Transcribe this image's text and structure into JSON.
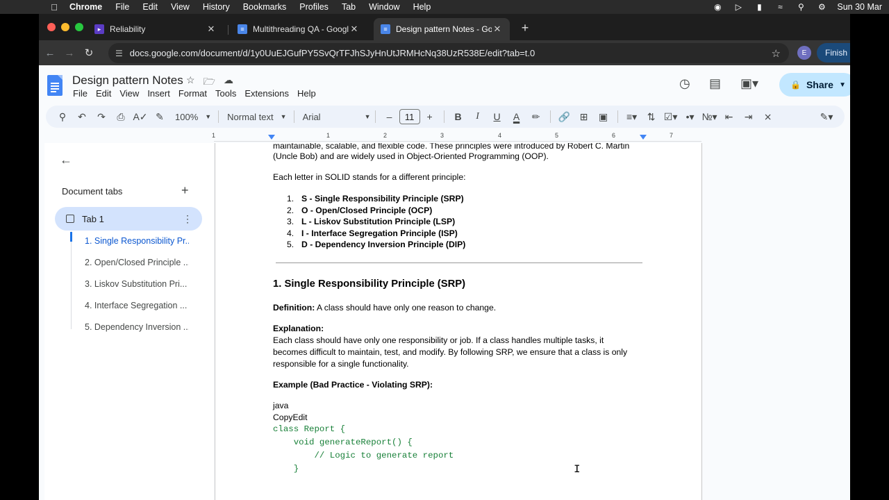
{
  "macos": {
    "app_name": "Chrome",
    "menu": [
      "File",
      "Edit",
      "View",
      "History",
      "Bookmarks",
      "Profiles",
      "Tab",
      "Window",
      "Help"
    ],
    "clock": "Sun 30 Mar"
  },
  "browser": {
    "tabs": [
      {
        "title": "Reliability"
      },
      {
        "title": "Multithreading QA - Google D"
      },
      {
        "title": "Design pattern Notes - Googl"
      }
    ],
    "url": "docs.google.com/document/d/1y0UuEJGufPY5SvQrTFJhSJyHnUtJRMHcNq38UzR538E/edit?tab=t.0",
    "profile_initial": "E",
    "finish_label": "Finish u"
  },
  "docs": {
    "title": "Design pattern Notes",
    "menu": [
      "File",
      "Edit",
      "View",
      "Insert",
      "Format",
      "Tools",
      "Extensions",
      "Help"
    ],
    "share_label": "Share",
    "toolbar": {
      "zoom": "100%",
      "style": "Normal text",
      "font": "Arial",
      "font_size": "11"
    },
    "ruler_numbers": [
      "1",
      "1",
      "2",
      "3",
      "4",
      "5",
      "6",
      "7"
    ]
  },
  "sidebar": {
    "header": "Document tabs",
    "tab_name": "Tab 1",
    "outline": [
      "1. Single Responsibility Pr...",
      "2. Open/Closed Principle ...",
      "3. Liskov Substitution Pri...",
      "4. Interface Segregation ...",
      "5. Dependency Inversion ..."
    ]
  },
  "document": {
    "intro_line1": "maintainable, scalable, and flexible code. These principles were introduced by Robert C. Martin",
    "intro_line2": "(Uncle Bob) and are widely used in Object-Oriented Programming (OOP).",
    "letters_intro": "Each letter in SOLID stands for a different principle:",
    "principles": [
      {
        "num": "1.",
        "text": "S - Single Responsibility Principle (SRP)"
      },
      {
        "num": "2.",
        "text": "O - Open/Closed Principle (OCP)"
      },
      {
        "num": "3.",
        "text": "L - Liskov Substitution Principle (LSP)"
      },
      {
        "num": "4.",
        "text": "I - Interface Segregation Principle (ISP)"
      },
      {
        "num": "5.",
        "text": "D - Dependency Inversion Principle (DIP)"
      }
    ],
    "section_heading": "1. Single Responsibility Principle (SRP)",
    "definition_label": "Definition:",
    "definition_text": " A class should have only one reason to change.",
    "explanation_label": "Explanation:",
    "explanation_line1": "Each class should have only one responsibility or job. If a class handles multiple tasks, it",
    "explanation_line2": "becomes difficult to maintain, test, and modify. By following SRP, we ensure that a class is only",
    "explanation_line3": "responsible for a single functionality.",
    "example_heading": "Example (Bad Practice - Violating SRP):",
    "code_lang": "java",
    "copy_label": "CopyEdit",
    "code_lines": [
      "class Report {",
      "    void generateReport() {",
      "        // Logic to generate report",
      "    }"
    ]
  }
}
